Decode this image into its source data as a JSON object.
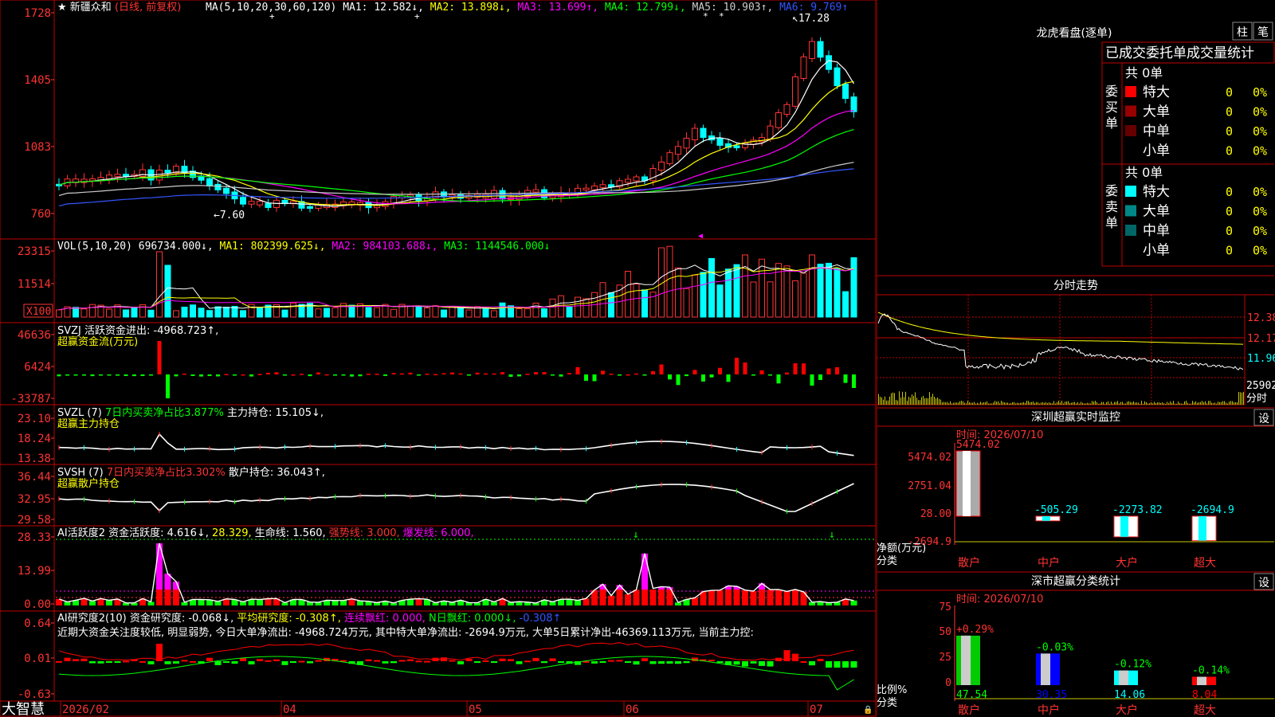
{
  "title": {
    "star": "★",
    "stock": "新疆众和",
    "period": "(日线, 前复权)",
    "ma": [
      {
        "text": "MA(5,10,20,30,60,120)",
        "color": "#ffffff"
      },
      {
        "text": "MA1: 12.582↓,",
        "color": "#ffffff"
      },
      {
        "text": "MA2: 13.898↓,",
        "color": "#ffff00"
      },
      {
        "text": "MA3: 13.699↑,",
        "color": "#ff00ff"
      },
      {
        "text": "MA4: 12.799↓,",
        "color": "#00ff00"
      },
      {
        "text": "MA5: 10.903↑,",
        "color": "#cccccc"
      },
      {
        "text": "MA6: 9.769↑",
        "color": "#3355ff"
      }
    ]
  },
  "price_axis": [
    "1728",
    "1405",
    "1083",
    "760"
  ],
  "annot": {
    "high": "17.28",
    "low": "7.60"
  },
  "vol_panel": {
    "axis": [
      "23315",
      "11514",
      "X100"
    ],
    "header": [
      {
        "text": "VOL(5,10,20)",
        "color": "#ffffff"
      },
      {
        "text": "696734.000↓,",
        "color": "#ffffff"
      },
      {
        "text": "MA1: 802399.625↓,",
        "color": "#ffff00"
      },
      {
        "text": "MA2: 984103.688↓,",
        "color": "#ff00ff"
      },
      {
        "text": "MA3: 1144546.000↓",
        "color": "#00ff00"
      }
    ]
  },
  "svzj_panel": {
    "axis": [
      "46636",
      "6424",
      "-33787"
    ],
    "line1": [
      {
        "text": "SVZJ",
        "color": "#ffffff"
      },
      {
        "text": "活跃资金进出: -4968.723↑,",
        "color": "#ffffff"
      }
    ],
    "line2": "超赢资金流(万元)"
  },
  "svzl_panel": {
    "axis": [
      "23.10",
      "18.24",
      "13.38"
    ],
    "line1": [
      {
        "text": "SVZL (7)",
        "color": "#ffffff"
      },
      {
        "text": "7日内买卖净占比3.877%",
        "color": "#00ff00"
      },
      {
        "text": "主力持仓: 15.105↓,",
        "color": "#ffffff"
      }
    ],
    "line2": "超赢主力持仓"
  },
  "svsh_panel": {
    "axis": [
      "36.44",
      "32.95",
      "29.58"
    ],
    "line1": [
      {
        "text": "SVSH (7)",
        "color": "#ffffff"
      },
      {
        "text": "7日内买卖净占比3.302%",
        "color": "#ff3333"
      },
      {
        "text": "散户持仓: 36.043↑,",
        "color": "#ffffff"
      }
    ],
    "line2": "超赢散户持仓"
  },
  "ai1_panel": {
    "axis": [
      "28.33",
      "13.99",
      "0.00"
    ],
    "line1": [
      {
        "text": "AI活跃度2 资金活跃度: 4.616↓,",
        "color": "#ffffff"
      },
      {
        "text": "28.329,",
        "color": "#ffff00"
      },
      {
        "text": "生命线: 1.560,",
        "color": "#ffffff"
      },
      {
        "text": "强势线: 3.000,",
        "color": "#ff3333"
      },
      {
        "text": "爆发线: 6.000,",
        "color": "#ff00ff"
      }
    ]
  },
  "ai2_panel": {
    "axis": [
      "0.64",
      "0.01",
      "-0.63"
    ],
    "line1": [
      {
        "text": "AI研究度2(10) 资金研究度: -0.068↓,",
        "color": "#ffffff"
      },
      {
        "text": "平均研究度: -0.308↑,",
        "color": "#ffff00"
      },
      {
        "text": "连续飘红: 0.000,",
        "color": "#ff00ff"
      },
      {
        "text": "N日飘红: 0.000↓,",
        "color": "#00ff00"
      },
      {
        "text": "-0.308↑",
        "color": "#3355ff"
      }
    ],
    "line2": "近期大资金关注度较低, 明显弱势, 今日大单净流出: -4968.724万元, 其中特大单净流出: -2694.9万元, 大单5日累计净出-46369.113万元, 当前主力控:"
  },
  "bottom_bar": {
    "brand": "大智慧",
    "dates": [
      "2026/02",
      "04",
      "05",
      "06",
      "07"
    ],
    "lock": "🔒"
  },
  "right": {
    "lhb_title": "龙虎看盘(逐单)",
    "btn1": "柱",
    "btn2": "笔",
    "tabs": "已成交委托单成交量统计",
    "buy_label": "委买单",
    "sell_label": "委卖单",
    "buy_total": "共 0单",
    "sell_total": "共 0单",
    "buy_rows": [
      {
        "label": "特大",
        "count": "0",
        "pct": "0%",
        "color": "#ff0000"
      },
      {
        "label": "大单",
        "count": "0",
        "pct": "0%",
        "color": "#990000"
      },
      {
        "label": "中单",
        "count": "0",
        "pct": "0%",
        "color": "#660000"
      },
      {
        "label": "小单",
        "count": "0",
        "pct": "0%",
        "color": ""
      }
    ],
    "sell_rows": [
      {
        "label": "特大",
        "count": "0",
        "pct": "0%",
        "color": "#00ffff"
      },
      {
        "label": "大单",
        "count": "0",
        "pct": "0%",
        "color": "#008888"
      },
      {
        "label": "中单",
        "count": "0",
        "pct": "0%",
        "color": "#006666"
      },
      {
        "label": "小单",
        "count": "0",
        "pct": "0%",
        "color": ""
      }
    ],
    "intraday_title": "分时走势",
    "intraday_axis": [
      "12.38",
      "12.17",
      "11.96"
    ],
    "intraday_vol": "25902",
    "intraday_foot": "分时",
    "monitor": {
      "title": "深圳超赢实时监控",
      "set_btn": "设",
      "time": "时间: 2026/07/10",
      "axis": [
        "5474.02",
        "2751.04",
        "28.00",
        "-2694.9"
      ],
      "ylabel1": "净额(万元)",
      "ylabel2": "分类",
      "bars": [
        {
          "cat": "散户",
          "value": 5474.02,
          "label": "5474.02"
        },
        {
          "cat": "中户",
          "value": -505.29,
          "label": "-505.29"
        },
        {
          "cat": "大户",
          "value": -2273.82,
          "label": "-2273.82"
        },
        {
          "cat": "超大",
          "value": -2694.9,
          "label": "-2694.9"
        }
      ]
    },
    "classify": {
      "title": "深市超赢分类统计",
      "set_btn": "设",
      "time": "时间: 2026/07/10",
      "axis": [
        "75",
        "50",
        "25",
        "0"
      ],
      "ylabel1": "比例%",
      "ylabel2": "分类",
      "bars": [
        {
          "cat": "散户",
          "value": 47.54,
          "label": "47.54",
          "change": "+0.29%"
        },
        {
          "cat": "中户",
          "value": 30.35,
          "label": "30.35",
          "change": "-0.03%"
        },
        {
          "cat": "大户",
          "value": 14.06,
          "label": "14.06",
          "change": "-0.12%"
        },
        {
          "cat": "超大",
          "value": 8.04,
          "label": "8.04",
          "change": "-0.14%"
        }
      ]
    }
  }
}
